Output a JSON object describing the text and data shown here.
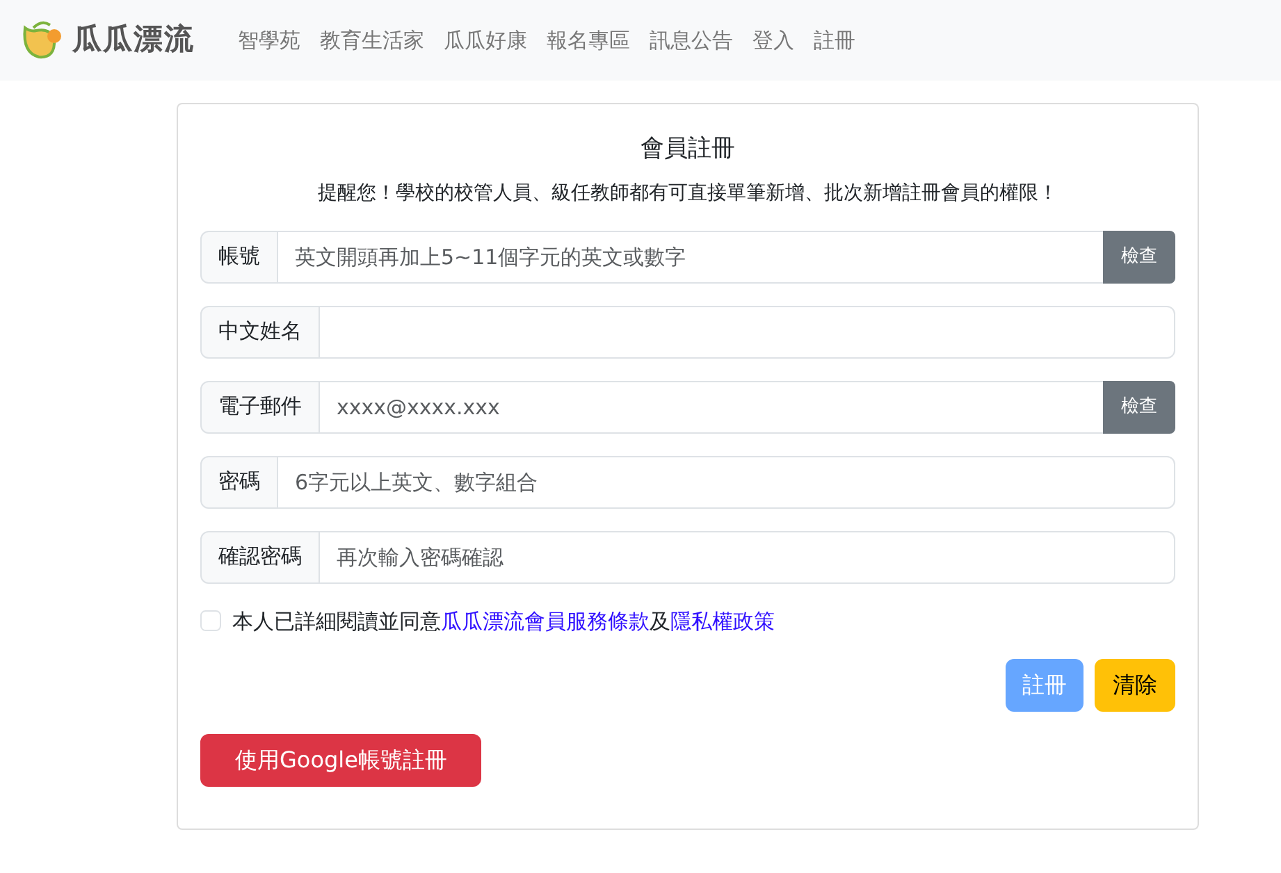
{
  "navbar": {
    "brand": "瓜瓜漂流",
    "links": [
      {
        "label": "智學苑"
      },
      {
        "label": "教育生活家"
      },
      {
        "label": "瓜瓜好康"
      },
      {
        "label": "報名專區"
      },
      {
        "label": "訊息公告"
      },
      {
        "label": "登入"
      },
      {
        "label": "註冊"
      }
    ]
  },
  "form": {
    "title": "會員註冊",
    "notice": "提醒您！學校的校管人員、級任教師都有可直接單筆新增、批次新增註冊會員的權限！",
    "fields": [
      {
        "label": "帳號",
        "placeholder": "英文開頭再加上5~11個字元的英文或數字",
        "button": "檢查"
      },
      {
        "label": "中文姓名"
      },
      {
        "label": "電子郵件",
        "placeholder": "xxxx@xxxx.xxx",
        "button": "檢查"
      },
      {
        "label": "密碼",
        "placeholder": "6字元以上英文、數字組合"
      },
      {
        "label": "確認密碼",
        "placeholder": "再次輸入密碼確認"
      }
    ],
    "agreement": {
      "checked": false,
      "text": "本人已詳細閱讀並同意",
      "terms_link": "瓜瓜漂流會員服務條款",
      "joiner": "及",
      "privacy_link": "隱私權政策"
    },
    "submit": {
      "label": "註冊",
      "disabled": true
    },
    "clear": {
      "label": "清除"
    },
    "google": {
      "label": "使用Google帳號註冊"
    }
  }
}
